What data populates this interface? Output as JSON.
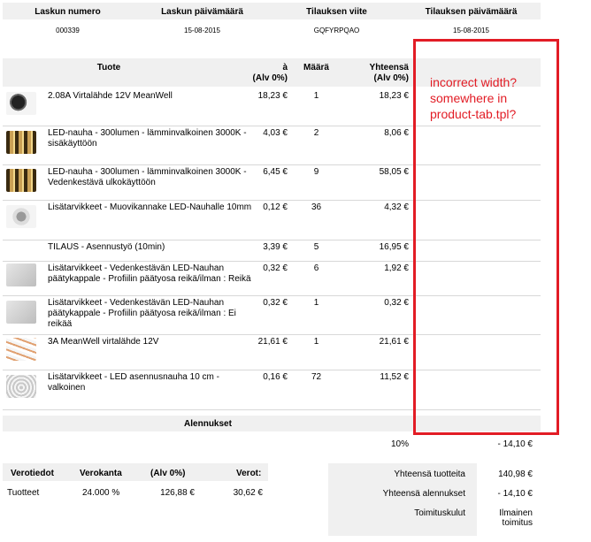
{
  "invoice_header": {
    "columns": [
      "Laskun numero",
      "Laskun päivämäärä",
      "Tilauksen viite",
      "Tilauksen päivämäärä"
    ],
    "values": [
      "000339",
      "15-08-2015",
      "GQFYRPQAO",
      "15-08-2015"
    ]
  },
  "products_header": {
    "product": "Tuote",
    "price_line1": "à",
    "price_line2": "(Alv 0%)",
    "qty": "Määrä",
    "total_line1": "Yhteensä",
    "total_line2": "(Alv 0%)"
  },
  "products": [
    {
      "name": "2.08A Virtalähde 12V MeanWell",
      "price": "18,23 €",
      "qty": "1",
      "total": "18,23 €",
      "thumb": "adapter-thumbnail"
    },
    {
      "name": "LED-nauha - 300lumen - lämminvalkoinen 3000K - sisäkäyttöön",
      "price": "4,03 €",
      "qty": "2",
      "total": "8,06 €",
      "thumb": "led-strip-thumbnail"
    },
    {
      "name": "LED-nauha - 300lumen - lämminvalkoinen 3000K - Vedenkestävä ulkokäyttöön",
      "price": "6,45 €",
      "qty": "9",
      "total": "58,05 €",
      "thumb": "led-strip-thumbnail"
    },
    {
      "name": "Lisätarvikkeet - Muovikannake LED-Nauhalle 10mm",
      "price": "0,12 €",
      "qty": "36",
      "total": "4,32 €",
      "thumb": "bracket-thumbnail"
    },
    {
      "name": "TILAUS - Asennustyö (10min)",
      "price": "3,39 €",
      "qty": "5",
      "total": "16,95 €",
      "thumb": ""
    },
    {
      "name": "Lisätarvikkeet - Vedenkestävän LED-Nauhan päätykappale - Profiilin päätyosa reikä/ilman : Reikä",
      "price": "0,32 €",
      "qty": "6",
      "total": "1,92 €",
      "thumb": "endcap-thumbnail"
    },
    {
      "name": "Lisätarvikkeet - Vedenkestävän LED-Nauhan päätykappale - Profiilin päätyosa reikä/ilman : Ei reikää",
      "price": "0,32 €",
      "qty": "1",
      "total": "0,32 €",
      "thumb": "endcap-thumbnail"
    },
    {
      "name": "3A MeanWell virtalähde 12V",
      "price": "21,61 €",
      "qty": "1",
      "total": "21,61 €",
      "thumb": "strip-thumbnail"
    },
    {
      "name": "Lisätarvikkeet - LED asennusnauha 10 cm - valkoinen",
      "price": "0,16 €",
      "qty": "72",
      "total": "11,52 €",
      "thumb": "coil-thumbnail"
    }
  ],
  "discounts": {
    "title": "Alennukset",
    "percent": "10%",
    "amount": "- 14,10 €"
  },
  "tax": {
    "headers": [
      "Verotiedot",
      "Verokanta",
      "(Alv 0%)",
      "Verot:"
    ],
    "row": [
      "Tuotteet",
      "24.000 %",
      "126,88 €",
      "30,62 €"
    ]
  },
  "totals": [
    {
      "label": "Yhteensä tuotteita",
      "value": "140,98 €"
    },
    {
      "label": "Yhteensä alennukset",
      "value": "- 14,10 €"
    },
    {
      "label": "Toimituskulut",
      "value": "Ilmainen toimitus"
    }
  ],
  "annotation": {
    "text": "incorrect width? somewhere in product-tab.tpl?",
    "color": "#e21c25"
  }
}
